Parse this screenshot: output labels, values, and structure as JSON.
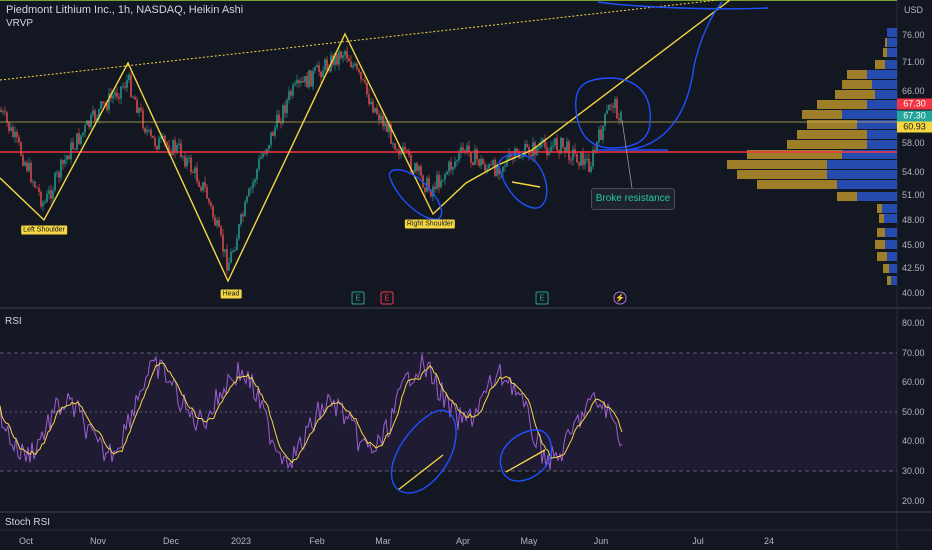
{
  "header": {
    "title": "Piedmont Lithium Inc., 1h, NASDAQ, Heikin Ashi",
    "indicator": "VRVP",
    "currency": "USD"
  },
  "price_axis": {
    "ticks": [
      "76.00",
      "71.00",
      "66.00",
      "58.00",
      "54.00",
      "51.00",
      "48.00",
      "45.00",
      "42.50",
      "40.00"
    ],
    "tags": [
      {
        "label": "67.30",
        "color": "#f23645"
      },
      {
        "label": "67.30",
        "color": "#26a69a"
      },
      {
        "label": "60.93",
        "color": "#f5d742",
        "text_color": "#131722"
      }
    ]
  },
  "rsi_axis": {
    "ticks": [
      "80.00",
      "70.00",
      "60.00",
      "50.00",
      "40.00",
      "30.00",
      "20.00"
    ]
  },
  "time_axis": {
    "ticks": [
      "Oct",
      "Nov",
      "Dec",
      "2023",
      "Feb",
      "Mar",
      "Apr",
      "May",
      "Jun",
      "Jul",
      "24"
    ]
  },
  "panes": {
    "rsi_label": "RSI",
    "stoch_label": "Stoch RSI"
  },
  "annotations": {
    "left_shoulder": "Left Shoulder",
    "head": "Head",
    "right_shoulder": "Right Shoulder",
    "callout": "Broke resistance"
  },
  "events": [
    {
      "glyph": "E",
      "color": "#2a9d8f"
    },
    {
      "glyph": "E",
      "color": "#f23645"
    },
    {
      "glyph": "E",
      "color": "#2a9d8f"
    },
    {
      "glyph": "⚡",
      "color": "#b26bd6"
    }
  ],
  "colors": {
    "background": "#131722",
    "candle_up": "#26a69a",
    "candle_down": "#ef5350",
    "pattern_line": "#f5d742",
    "resistance_line": "#f23645",
    "drawing_blue": "#1e50ff",
    "rsi_line": "#9c5fd0",
    "rsi_ma": "#f5d742",
    "vp_blue": "#2a55c8",
    "vp_gold": "#b8902a"
  }
}
